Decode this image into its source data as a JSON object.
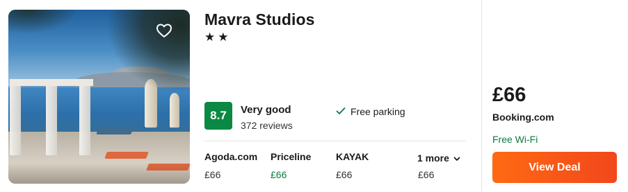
{
  "hotel": {
    "name": "Mavra Studios",
    "stars": "★★",
    "star_count": 2,
    "score": "8.7",
    "rating_label": "Very good",
    "reviews": "372 reviews",
    "amenity": "Free parking"
  },
  "providers": [
    {
      "name": "Agoda.com",
      "price": "£66",
      "best": false
    },
    {
      "name": "Priceline",
      "price": "£66",
      "best": true
    },
    {
      "name": "KAYAK",
      "price": "£66",
      "best": false
    }
  ],
  "more": {
    "label": "1 more",
    "price": "£66"
  },
  "deal": {
    "price": "£66",
    "site": "Booking.com",
    "perk": "Free Wi-Fi",
    "button_label": "View Deal"
  },
  "colors": {
    "score_bg": "#0b8843",
    "best_price": "#0b7a3e",
    "button_start": "#ff6a13",
    "button_end": "#f2471b"
  },
  "icons": {
    "favorite": "heart-outline-icon",
    "amenity": "check-icon",
    "more": "chevron-down-icon"
  }
}
